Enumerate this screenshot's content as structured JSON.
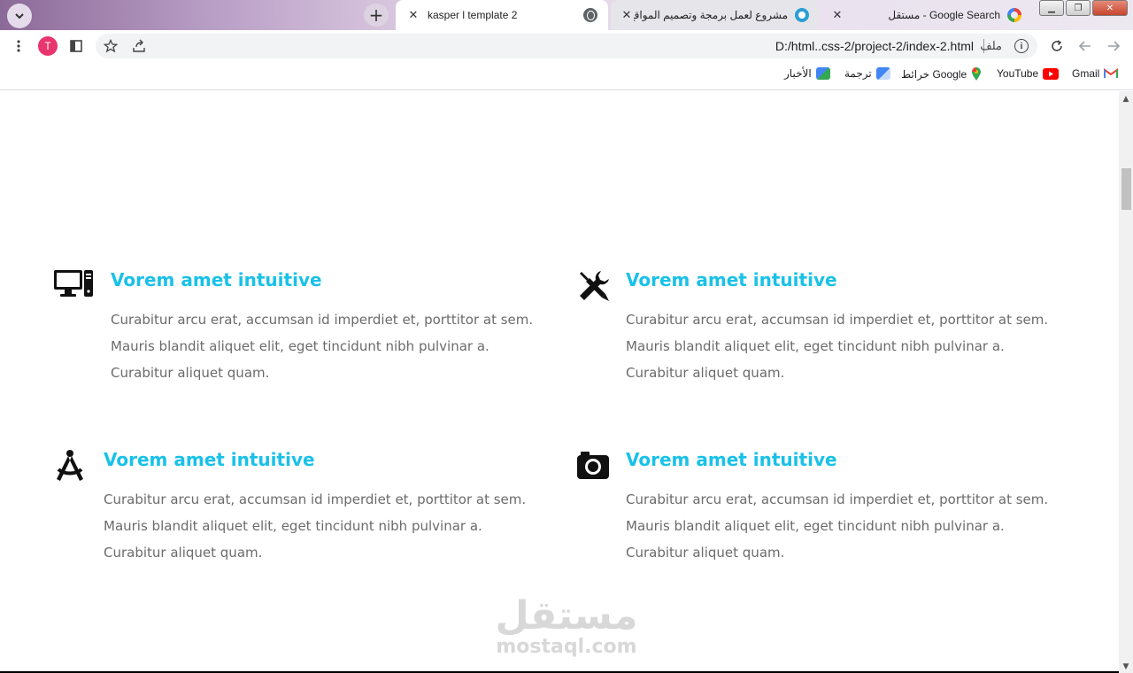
{
  "tabs": [
    {
      "title": "kasper l template 2",
      "active": true
    },
    {
      "title": "مشروع لعمل برمجة وتصميم المواقع | مستقل",
      "active": false
    },
    {
      "title": "Google Search - مستقل",
      "active": false
    }
  ],
  "toolbar": {
    "avatar_letter": "T",
    "url": "D:/html..css-2/project-2/index-2.html",
    "file_label": "ملف",
    "info_icon": "i"
  },
  "bookmarks": [
    {
      "label": "Gmail",
      "icon": "gmail-icon"
    },
    {
      "label": "YouTube",
      "icon": "youtube-icon"
    },
    {
      "label": "خرائط Google",
      "icon": "maps-icon"
    },
    {
      "label": "ترجمة",
      "icon": "translate-icon"
    },
    {
      "label": "الأخبار",
      "icon": "news-icon"
    }
  ],
  "features": [
    {
      "title": "Vorem amet intuitive",
      "text": "Curabitur arcu erat, accumsan id imperdiet et, porttitor at sem. Mauris blandit aliquet elit, eget tincidunt nibh pulvinar a. Curabitur aliquet quam.",
      "icon": "desktop-icon"
    },
    {
      "title": "Vorem amet intuitive",
      "text": "Curabitur arcu erat, accumsan id imperdiet et, porttitor at sem. Mauris blandit aliquet elit, eget tincidunt nibh pulvinar a. Curabitur aliquet quam.",
      "icon": "tools-icon"
    },
    {
      "title": "Vorem amet intuitive",
      "text": "Curabitur arcu erat, accumsan id imperdiet et, porttitor at sem. Mauris blandit aliquet elit, eget tincidunt nibh pulvinar a. Curabitur aliquet quam.",
      "icon": "compass-icon"
    },
    {
      "title": "Vorem amet intuitive",
      "text": "Curabitur arcu erat, accumsan id imperdiet et, porttitor at sem. Mauris blandit aliquet elit, eget tincidunt nibh pulvinar a. Curabitur aliquet quam.",
      "icon": "camera-icon"
    }
  ],
  "watermark": {
    "arabic": "مستقل",
    "latin": "mostaql.com"
  },
  "colors": {
    "accent": "#19c1e8",
    "body_text": "#6b6b6b",
    "avatar": "#e8356d"
  }
}
